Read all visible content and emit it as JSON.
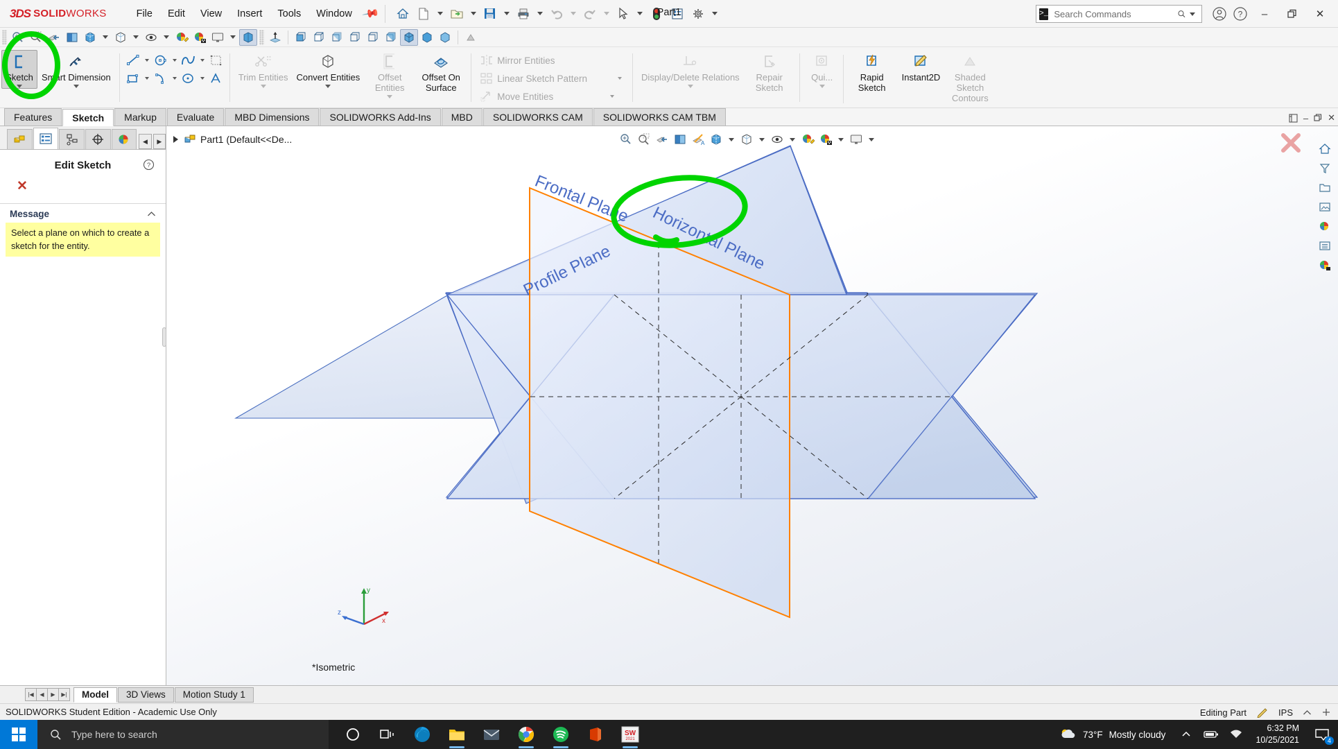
{
  "app": {
    "brand_ds": "3DS",
    "brand_solid": "SOLID",
    "brand_works": "WORKS",
    "document_title": "Part1",
    "accent_color": "#d41f26",
    "highlight_color": "#00d400"
  },
  "menubar": {
    "items": [
      {
        "label": "File"
      },
      {
        "label": "Edit"
      },
      {
        "label": "View"
      },
      {
        "label": "Insert"
      },
      {
        "label": "Tools"
      },
      {
        "label": "Window"
      }
    ],
    "pin_icon": "pin-icon"
  },
  "quick_access": {
    "buttons": [
      {
        "name": "home-icon",
        "label": "Home"
      },
      {
        "name": "new-document-icon",
        "label": "New"
      },
      {
        "name": "open-folder-icon",
        "label": "Open"
      },
      {
        "name": "save-icon",
        "label": "Save"
      },
      {
        "name": "print-icon",
        "label": "Print"
      },
      {
        "name": "undo-icon",
        "label": "Undo"
      },
      {
        "name": "redo-icon",
        "label": "Redo"
      },
      {
        "name": "select-cursor-icon",
        "label": "Select"
      },
      {
        "name": "rebuild-icon",
        "label": "Rebuild"
      },
      {
        "name": "options-list-icon",
        "label": "Options List"
      },
      {
        "name": "gear-icon",
        "label": "Options"
      }
    ]
  },
  "search": {
    "placeholder": "Search Commands",
    "value": "",
    "icon": "search-icon"
  },
  "window_controls": {
    "account": "account-icon",
    "help": "help-icon",
    "minimize": "–",
    "restore": "restore-icon",
    "close": "✕"
  },
  "view_toolbar": {
    "buttons": [
      {
        "name": "zoom-to-fit-icon"
      },
      {
        "name": "zoom-to-area-icon"
      },
      {
        "name": "section-view-icon"
      },
      {
        "name": "view-orientation-icon"
      },
      {
        "name": "display-style-icon"
      },
      {
        "name": "hide-show-items-icon"
      },
      {
        "name": "edit-appearance-icon"
      },
      {
        "name": "apply-scene-icon"
      },
      {
        "name": "view-settings-icon"
      },
      {
        "name": "normal-to-icon"
      }
    ],
    "orientation_cubes": 9
  },
  "ribbon": {
    "groups": [
      {
        "name": "sketch-group",
        "buttons": [
          {
            "name": "sketch-button",
            "label": "Sketch",
            "icon": "sketch-icon",
            "state": "selected",
            "has_dropdown": true
          },
          {
            "name": "smart-dimension-button",
            "label": "Smart Dimension",
            "icon": "smart-dimension-icon",
            "state": "normal",
            "has_dropdown": true
          }
        ]
      },
      {
        "name": "entities-group",
        "small_tools": [
          {
            "name": "line-tool-icon",
            "dropdown": true
          },
          {
            "name": "circle-tool-icon",
            "dropdown": true
          },
          {
            "name": "spline-tool-icon",
            "dropdown": true
          },
          {
            "name": "rectangle-tool-icon",
            "dropdown": true
          },
          {
            "name": "arc-tool-icon",
            "dropdown": true
          },
          {
            "name": "ellipse-tool-icon",
            "dropdown": true
          },
          {
            "name": "sketch-fillet-icon",
            "dropdown": true
          },
          {
            "name": "point-tool-icon",
            "dropdown": true
          },
          {
            "name": "text-tool-icon",
            "dropdown": false
          },
          {
            "name": "plane-tool-icon",
            "dropdown": false
          }
        ]
      },
      {
        "name": "edit-group",
        "buttons": [
          {
            "name": "trim-entities-button",
            "label": "Trim Entities",
            "icon": "trim-entities-icon",
            "state": "disabled",
            "has_dropdown": true
          },
          {
            "name": "convert-entities-button",
            "label": "Convert Entities",
            "icon": "convert-entities-icon",
            "state": "normal",
            "has_dropdown": true
          },
          {
            "name": "offset-entities-button",
            "label": "Offset Entities",
            "icon": "offset-entities-icon",
            "state": "disabled",
            "has_dropdown": true
          },
          {
            "name": "offset-on-surface-button",
            "label": "Offset On Surface",
            "icon": "offset-on-surface-icon",
            "state": "normal",
            "has_dropdown": false
          }
        ]
      },
      {
        "name": "pattern-group",
        "rows": [
          {
            "name": "mirror-entities-button",
            "label": "Mirror Entities",
            "icon": "mirror-entities-icon",
            "state": "disabled",
            "has_dropdown": false
          },
          {
            "name": "linear-sketch-pattern-button",
            "label": "Linear Sketch Pattern",
            "icon": "linear-sketch-pattern-icon",
            "state": "disabled",
            "has_dropdown": true
          },
          {
            "name": "move-entities-button",
            "label": "Move Entities",
            "icon": "move-entities-icon",
            "state": "disabled",
            "has_dropdown": true
          }
        ]
      },
      {
        "name": "relations-group",
        "buttons": [
          {
            "name": "display-delete-relations-button",
            "label": "Display/Delete Relations",
            "icon": "display-delete-relations-icon",
            "state": "disabled",
            "has_dropdown": true
          },
          {
            "name": "repair-sketch-button",
            "label": "Repair Sketch",
            "icon": "repair-sketch-icon",
            "state": "disabled",
            "has_dropdown": false
          }
        ]
      },
      {
        "name": "tools-group",
        "buttons": [
          {
            "name": "quick-snaps-button",
            "label": "Qui...",
            "icon": "quick-snaps-icon",
            "state": "disabled",
            "has_dropdown": true
          },
          {
            "name": "rapid-sketch-button",
            "label": "Rapid Sketch",
            "icon": "rapid-sketch-icon",
            "state": "normal",
            "has_dropdown": false
          },
          {
            "name": "instant2d-button",
            "label": "Instant2D",
            "icon": "instant2d-icon",
            "state": "normal",
            "has_dropdown": false
          },
          {
            "name": "shaded-sketch-contours-button",
            "label": "Shaded Sketch Contours",
            "icon": "shaded-sketch-contours-icon",
            "state": "disabled",
            "has_dropdown": false
          }
        ]
      }
    ]
  },
  "ribbon_tabs": {
    "items": [
      {
        "label": "Features",
        "active": false
      },
      {
        "label": "Sketch",
        "active": true
      },
      {
        "label": "Markup",
        "active": false
      },
      {
        "label": "Evaluate",
        "active": false
      },
      {
        "label": "MBD Dimensions",
        "active": false
      },
      {
        "label": "SOLIDWORKS Add-Ins",
        "active": false
      },
      {
        "label": "MBD",
        "active": false
      },
      {
        "label": "SOLIDWORKS CAM",
        "active": false
      },
      {
        "label": "SOLIDWORKS CAM TBM",
        "active": false
      }
    ]
  },
  "left_panel": {
    "tabs": [
      {
        "name": "feature-manager-tab",
        "icon": "feature-tree-icon",
        "active": false
      },
      {
        "name": "property-manager-tab",
        "icon": "property-manager-icon",
        "active": true
      },
      {
        "name": "configuration-manager-tab",
        "icon": "configuration-icon",
        "active": false
      },
      {
        "name": "dimxpert-manager-tab",
        "icon": "dimxpert-icon",
        "active": false
      },
      {
        "name": "display-manager-tab",
        "icon": "display-manager-icon",
        "active": false
      }
    ],
    "nav_prev": "◀",
    "nav_next": "▶",
    "property_manager": {
      "title": "Edit Sketch",
      "help_icon": "help-icon",
      "cancel_icon": "cancel-x-icon",
      "section_label": "Message",
      "collapse_icon": "chevron-up-icon",
      "message": "Select a plane on which to create a sketch for the entity."
    }
  },
  "feature_tree": {
    "root_label": "Part1  (Default<<De...",
    "expand_icon": "expand-arrow-icon",
    "part_icon": "part-icon"
  },
  "graphics": {
    "view_label": "*Isometric",
    "close_icon": "close-x-icon",
    "triad": {
      "x": "x",
      "y": "y",
      "z": "z"
    },
    "planes": [
      {
        "name": "Frontal Plane",
        "color": "#4a7ebb"
      },
      {
        "name": "Horizontal Plane",
        "color": "#4a7ebb"
      },
      {
        "name": "Profile Plane",
        "color": "#4a7ebb"
      }
    ],
    "highlighted_plane_outline": "#ff8000",
    "right_toolbar": [
      {
        "name": "view-home-icon"
      },
      {
        "name": "view-orientation-icon"
      },
      {
        "name": "view-previous-icon"
      },
      {
        "name": "view-section-icon"
      },
      {
        "name": "view-display-style-icon"
      },
      {
        "name": "view-hide-show-icon"
      },
      {
        "name": "view-scene-icon"
      }
    ]
  },
  "bottom_tabs": {
    "nav": [
      "|◀",
      "◀",
      "▶",
      "▶|"
    ],
    "items": [
      {
        "label": "Model",
        "active": true
      },
      {
        "label": "3D Views",
        "active": false
      },
      {
        "label": "Motion Study 1",
        "active": false
      }
    ]
  },
  "statusbar": {
    "license_text": "SOLIDWORKS Student Edition - Academic Use Only",
    "mode": "Editing Part",
    "units": "IPS",
    "sketch_icon": "sketch-status-icon",
    "expand_icon": "chevron-up-icon"
  },
  "taskbar": {
    "start_icon": "windows-start-icon",
    "search_placeholder": "Type here to search",
    "search_icon": "search-icon",
    "apps": [
      {
        "name": "cortana-icon",
        "running": false
      },
      {
        "name": "task-view-icon",
        "running": false
      },
      {
        "name": "microsoft-edge-icon",
        "running": false
      },
      {
        "name": "file-explorer-icon",
        "running": true
      },
      {
        "name": "mail-icon",
        "running": false
      },
      {
        "name": "google-chrome-icon",
        "running": true
      },
      {
        "name": "spotify-icon",
        "running": true
      },
      {
        "name": "office-icon",
        "running": false
      },
      {
        "name": "solidworks-icon",
        "running": true
      }
    ],
    "weather": {
      "icon": "partly-cloudy-icon",
      "temperature": "73°F",
      "condition": "Mostly cloudy"
    },
    "tray": [
      {
        "name": "show-hidden-icons-chevron"
      },
      {
        "name": "battery-icon"
      },
      {
        "name": "network-icon"
      }
    ],
    "clock": {
      "time": "6:32 PM",
      "date": "10/25/2021"
    },
    "notifications": {
      "icon": "action-center-icon",
      "count": "4"
    }
  },
  "annotations": {
    "sketch_button_circle": {
      "color": "#00d400",
      "shape": "ellipse"
    },
    "frontal_plane_circle": {
      "color": "#00d400",
      "shape": "ellipse"
    }
  }
}
